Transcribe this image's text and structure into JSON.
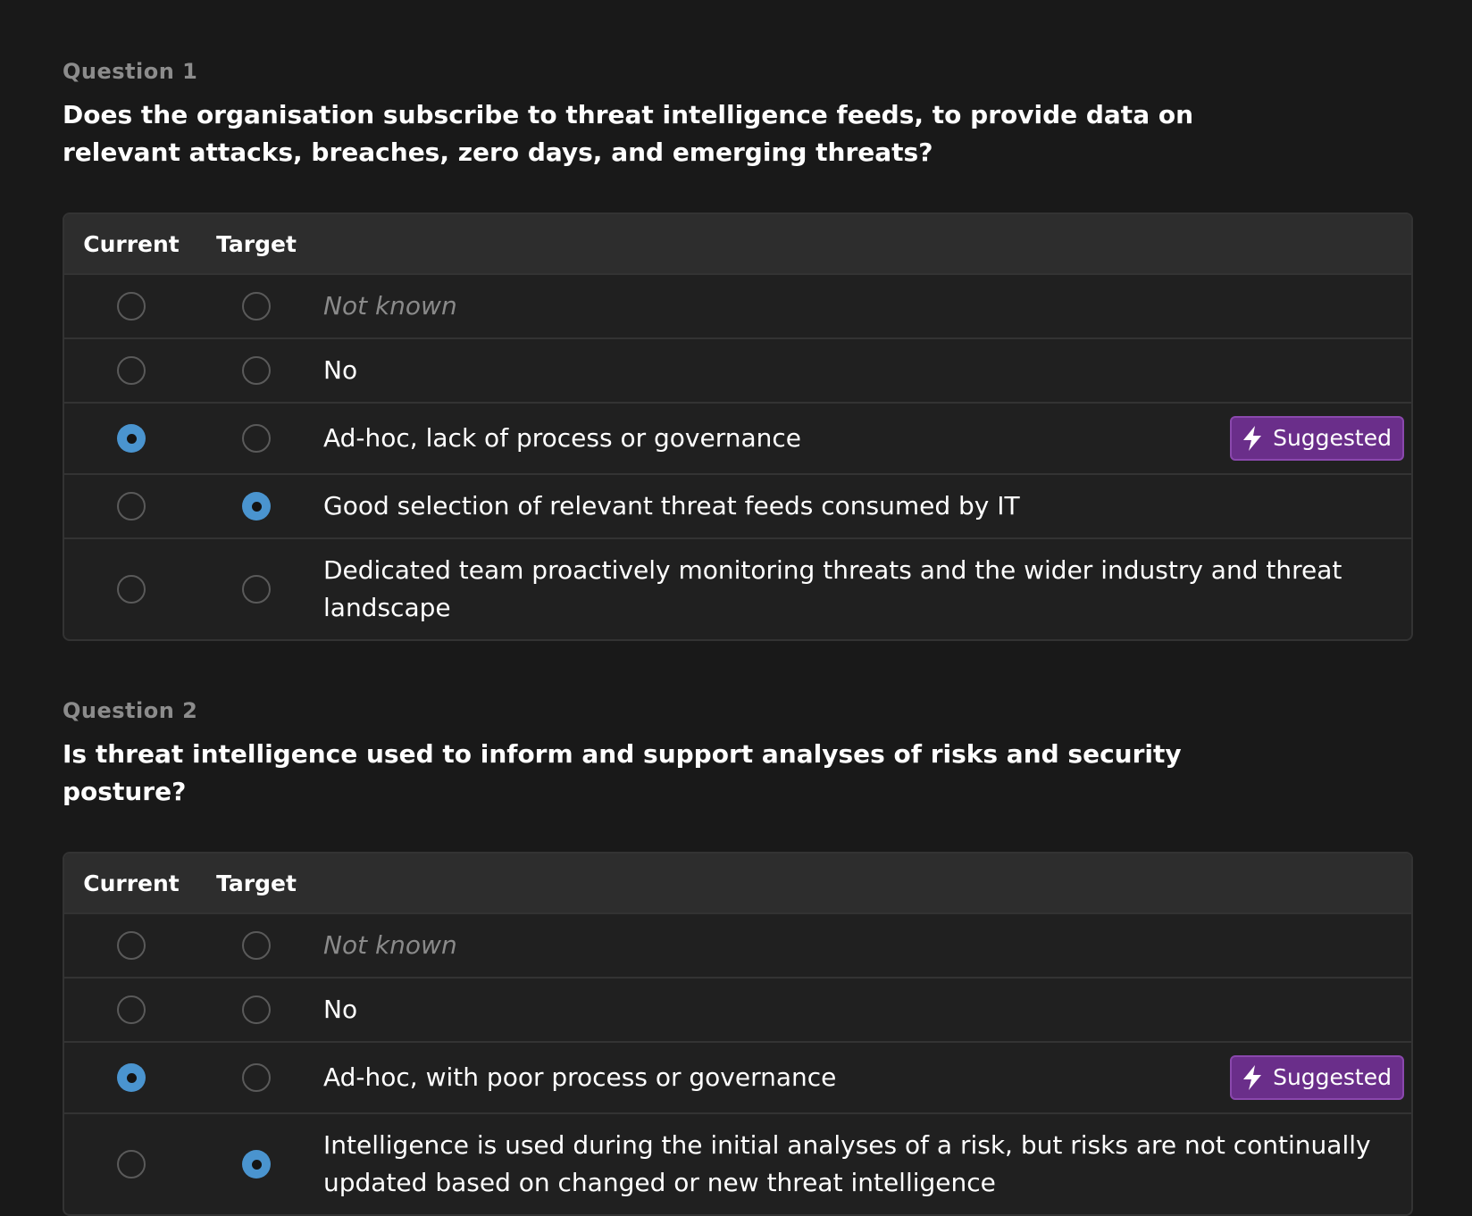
{
  "questions": [
    {
      "label": "Question 1",
      "text": "Does the organisation subscribe to threat intelligence feeds, to provide data on relevant attacks, breaches, zero days, and emerging threats?",
      "headers": {
        "current": "Current",
        "target": "Target"
      },
      "options": [
        {
          "label": "Not known",
          "muted": true,
          "current": false,
          "target": false,
          "badge": ""
        },
        {
          "label": "No",
          "muted": false,
          "current": false,
          "target": false,
          "badge": ""
        },
        {
          "label": "Ad-hoc, lack of process or governance",
          "muted": false,
          "current": true,
          "target": false,
          "badge": "Suggested"
        },
        {
          "label": "Good selection of relevant threat feeds consumed by IT",
          "muted": false,
          "current": false,
          "target": true,
          "badge": ""
        },
        {
          "label": "Dedicated team proactively monitoring threats and the wider industry and threat landscape",
          "muted": false,
          "current": false,
          "target": false,
          "badge": ""
        }
      ]
    },
    {
      "label": "Question 2",
      "text": "Is threat intelligence used to inform and support analyses of risks and security posture?",
      "headers": {
        "current": "Current",
        "target": "Target"
      },
      "options": [
        {
          "label": "Not known",
          "muted": true,
          "current": false,
          "target": false,
          "badge": ""
        },
        {
          "label": "No",
          "muted": false,
          "current": false,
          "target": false,
          "badge": ""
        },
        {
          "label": "Ad-hoc, with poor process or governance",
          "muted": false,
          "current": true,
          "target": false,
          "badge": "Suggested"
        },
        {
          "label": "Intelligence is used during the initial analyses of a risk, but risks are not continually updated based on changed or new threat intelligence",
          "muted": false,
          "current": false,
          "target": true,
          "badge": ""
        }
      ]
    }
  ],
  "icons": {
    "badge_icon": "lightning-bolt-icon"
  },
  "colors": {
    "background": "#191919",
    "radio_checked": "#4a94cf",
    "badge_bg": "#6a2e8a",
    "badge_border": "#8a48ad"
  }
}
